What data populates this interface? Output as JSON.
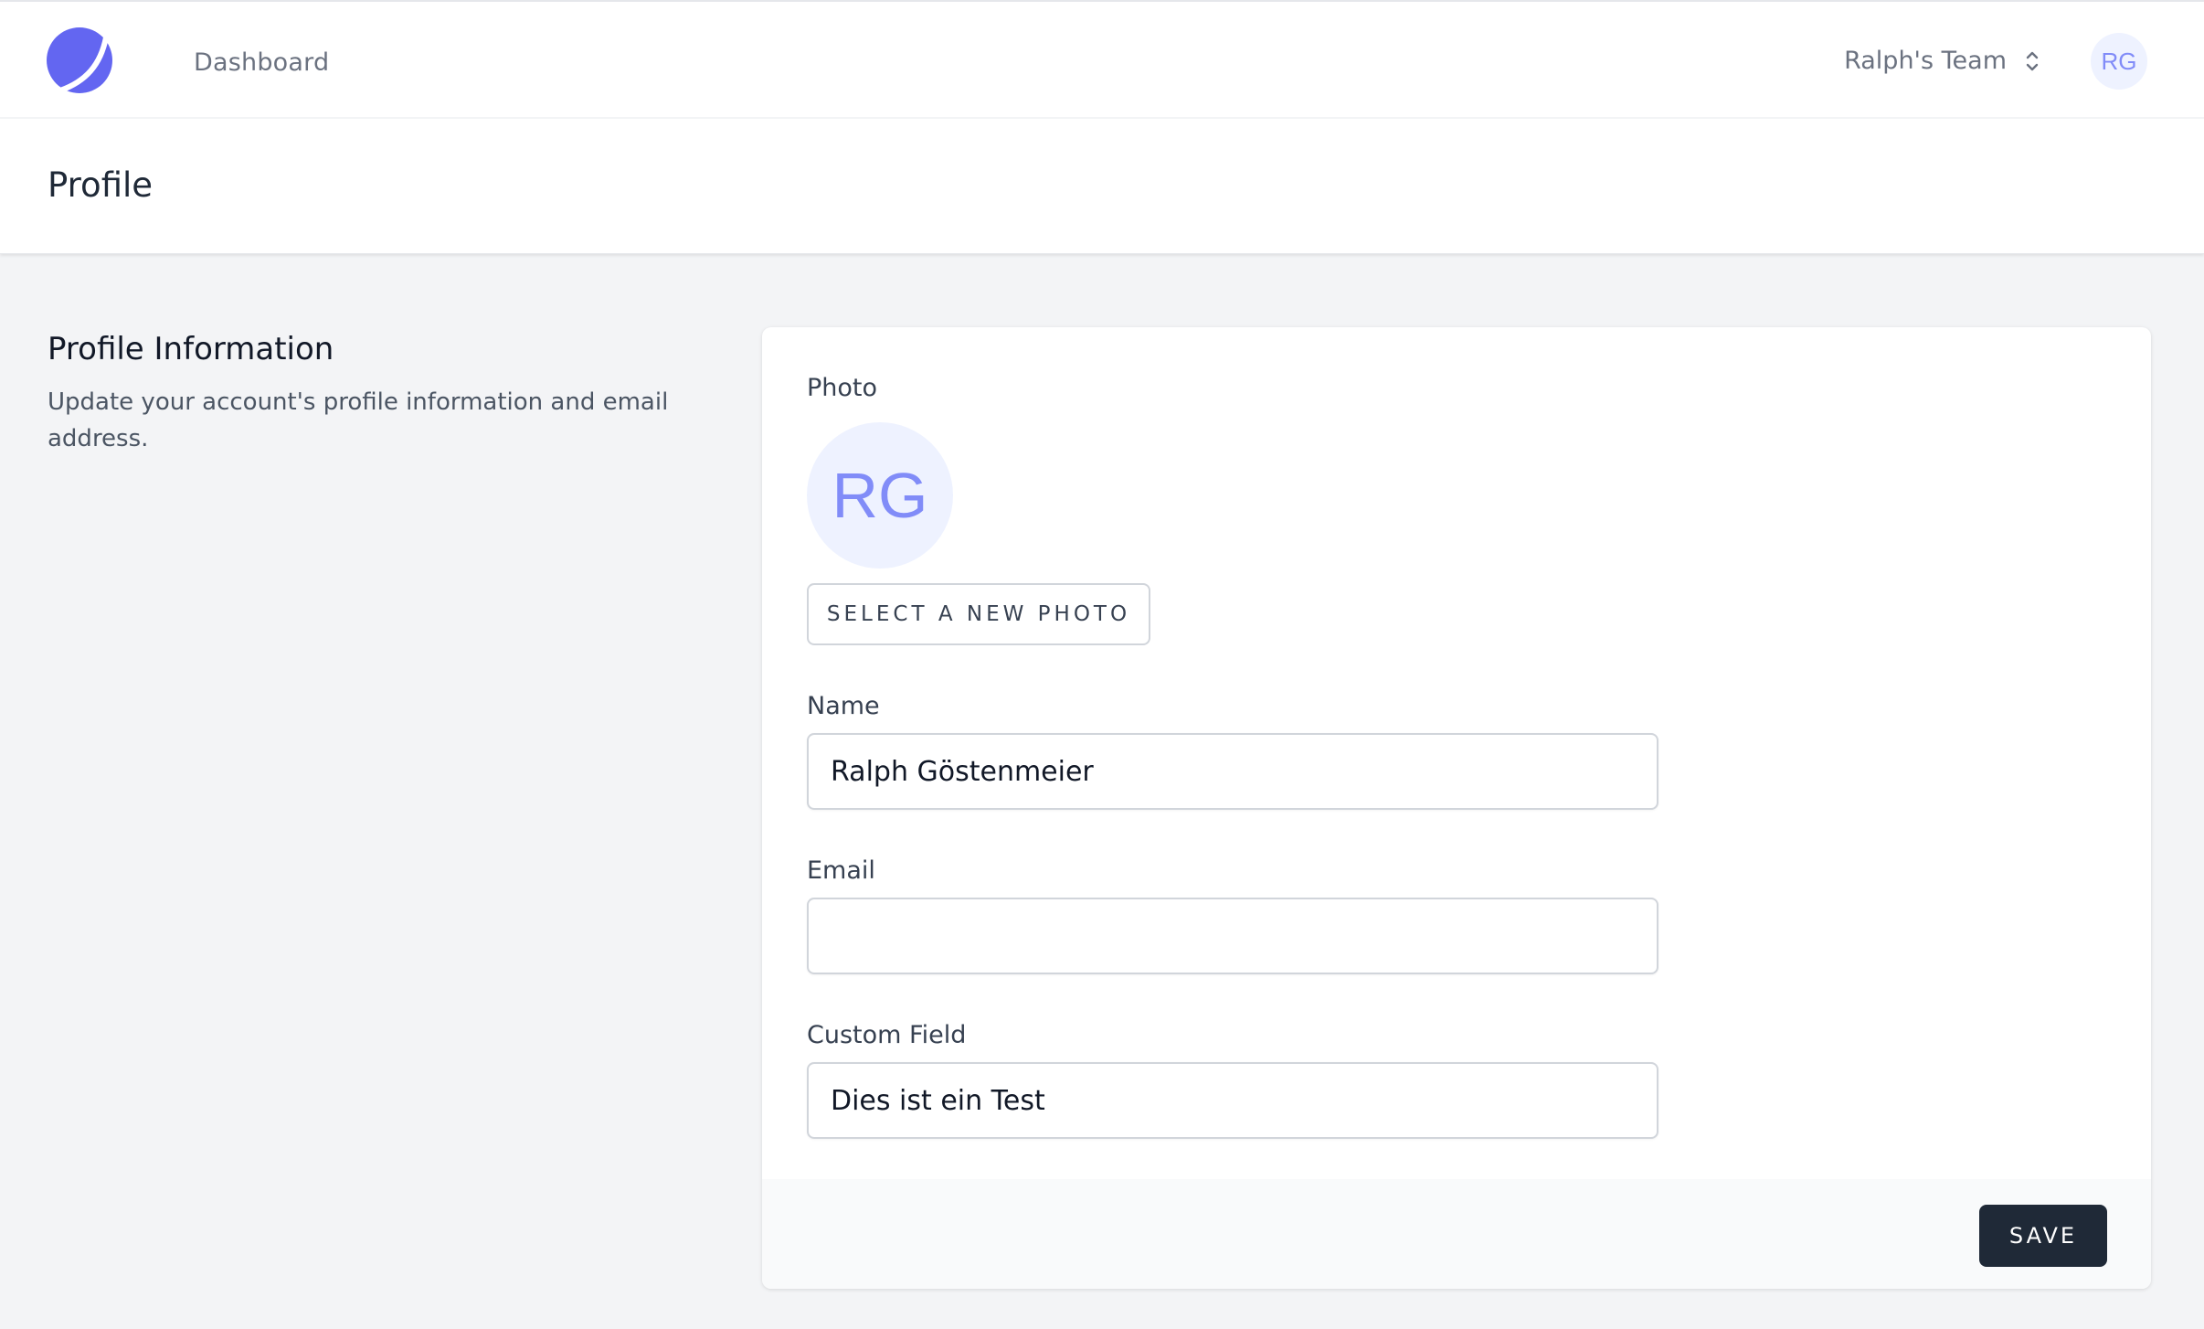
{
  "nav": {
    "logo_icon": "app-logo-icon",
    "dashboard_label": "Dashboard",
    "team_name": "Ralph's Team",
    "team_switch_icon": "selector-icon",
    "user_initials": "RG"
  },
  "header": {
    "title": "Profile"
  },
  "section": {
    "title": "Profile Information",
    "description": "Update your account's profile information and email address."
  },
  "form": {
    "photo_label": "Photo",
    "photo_initials": "RG",
    "select_photo_label": "SELECT A NEW PHOTO",
    "name_label": "Name",
    "name_value": "Ralph Göstenmeier",
    "email_label": "Email",
    "email_value": "",
    "custom_label": "Custom Field",
    "custom_value": "Dies ist ein Test",
    "save_label": "SAVE"
  },
  "colors": {
    "accent": "#6366f1",
    "avatar_bg": "#eef2ff",
    "avatar_text": "#818cf8",
    "button_dark": "#1f2937",
    "page_bg": "#f3f4f6"
  }
}
